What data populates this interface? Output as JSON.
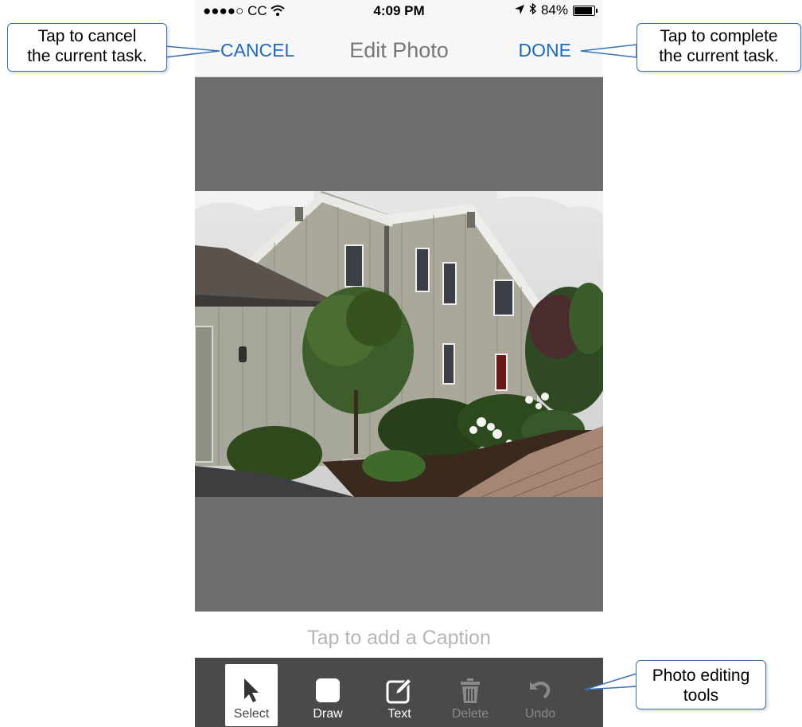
{
  "status_bar": {
    "carrier": "●●●●○ CC",
    "time": "4:09 PM",
    "battery": "84%",
    "battery_level": 0.84
  },
  "navbar": {
    "cancel_label": "CANCEL",
    "title": "Edit Photo",
    "done_label": "DONE"
  },
  "caption": {
    "placeholder": "Tap to add a Caption"
  },
  "toolbar": {
    "tools": [
      {
        "label": "Select",
        "icon": "pointer-arrow-icon",
        "state": "active"
      },
      {
        "label": "Draw",
        "icon": "rounded-square-icon",
        "state": "enabled"
      },
      {
        "label": "Text",
        "icon": "pencil-square-icon",
        "state": "enabled"
      },
      {
        "label": "Delete",
        "icon": "trash-icon",
        "state": "disabled"
      },
      {
        "label": "Undo",
        "icon": "undo-arrow-icon",
        "state": "disabled"
      }
    ]
  },
  "callouts": {
    "cancel": "Tap to cancel\nthe current task.",
    "done": "Tap to complete\nthe current task.",
    "tools": "Photo editing\ntools"
  },
  "colors": {
    "accent": "#1b6ac0",
    "callout_border": "#3b6fb6",
    "toolbar_bg": "#4a4a4a",
    "photo_matte": "#6d6d6d"
  }
}
